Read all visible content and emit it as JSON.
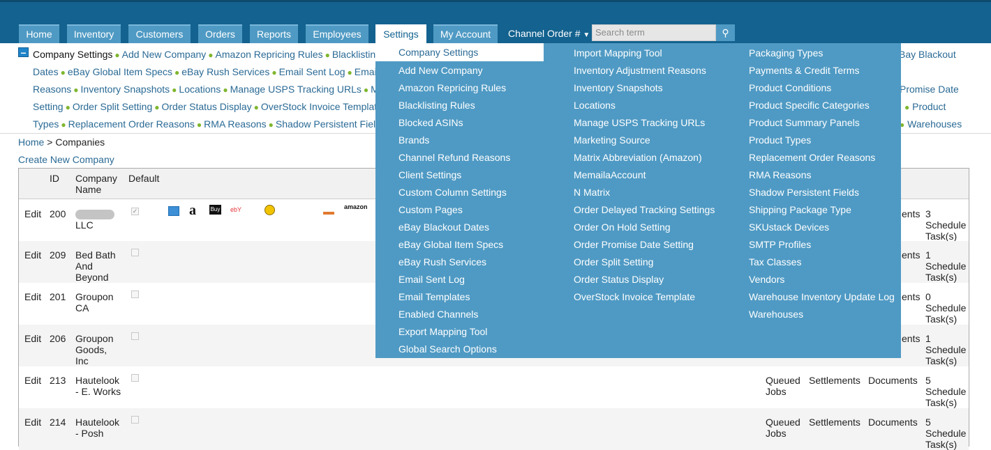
{
  "nav": {
    "tabs": [
      {
        "label": "Home"
      },
      {
        "label": "Inventory"
      },
      {
        "label": "Customers"
      },
      {
        "label": "Orders"
      },
      {
        "label": "Reports"
      },
      {
        "label": "Employees"
      },
      {
        "label": "Settings"
      },
      {
        "label": "My Account"
      }
    ],
    "channel_select": "Channel Order #",
    "channel_arrow": "▼",
    "search_placeholder": "Search term",
    "search_icon": "magnifier-icon"
  },
  "submenu": {
    "lines": [
      [
        "Company Settings",
        "Add New Company",
        "Amazon Repricing Rules",
        "Blacklisting R"
      ],
      [
        "Dates",
        "eBay Global Item Specs",
        "eBay Rush Services",
        "Email Sent Log",
        "Email T"
      ],
      [
        "Reasons",
        "Inventory Snapshots",
        "Locations",
        "Manage USPS Tracking URLs",
        "Ma"
      ],
      [
        "Setting",
        "Order Split Setting",
        "Order Status Display",
        "OverStock Invoice Template"
      ],
      [
        "Types",
        "Replacement Order Reasons",
        "RMA Reasons",
        "Shadow Persistent Fields"
      ]
    ],
    "right": [
      "Bay Blackout",
      "Promise Date",
      "Product",
      "Warehouses"
    ]
  },
  "breadcrumb": {
    "home": "Home",
    "sep": ">",
    "current": "Companies"
  },
  "create_link": "Create New Company",
  "table": {
    "headers": {
      "id": "ID",
      "name": "Company Name",
      "default": "Default"
    },
    "rows": [
      {
        "edit": "Edit",
        "id": "200",
        "name": "LLC",
        "default": true,
        "tasks": "3 Schedule Task(s)",
        "docs": "ents"
      },
      {
        "edit": "Edit",
        "id": "209",
        "name": "Bed Bath And Beyond",
        "default": false,
        "tasks": "1 Schedule Task(s)",
        "docs": "ents"
      },
      {
        "edit": "Edit",
        "id": "201",
        "name": "Groupon CA",
        "default": false,
        "tasks": "0 Schedule Task(s)",
        "docs": "ents"
      },
      {
        "edit": "Edit",
        "id": "206",
        "name": "Groupon Goods, Inc",
        "default": false,
        "tasks": "1 Schedule Task(s)",
        "docs": "ents"
      },
      {
        "edit": "Edit",
        "id": "213",
        "name": "Hautelook - E. Works",
        "default": false,
        "queued": "Queued Jobs",
        "settlements": "Settlements",
        "docs": "Documents",
        "tasks": "5 Schedule Task(s)"
      },
      {
        "edit": "Edit",
        "id": "214",
        "name": "Hautelook - Posh",
        "default": false,
        "queued": "Queued Jobs",
        "settlements": "Settlements",
        "docs": "Documents",
        "tasks": "5 Schedule Task(s)"
      }
    ],
    "logos": [
      "a",
      "Buy",
      "ebY",
      "amazon"
    ]
  },
  "dropdown": {
    "col1": [
      "Company Settings",
      "Add New Company",
      "Amazon Repricing Rules",
      "Blacklisting Rules",
      "Blocked ASINs",
      "Brands",
      "Channel Refund Reasons",
      "Client Settings",
      "Custom Column Settings",
      "Custom Pages",
      "eBay Blackout Dates",
      "eBay Global Item Specs",
      "eBay Rush Services",
      "Email Sent Log",
      "Email Templates",
      "Enabled Channels",
      "Export Mapping Tool",
      "Global Search Options"
    ],
    "col2": [
      "Import Mapping Tool",
      "Inventory Adjustment Reasons",
      "Inventory Snapshots",
      "Locations",
      "Manage USPS Tracking URLs",
      "Marketing Source",
      "Matrix Abbreviation (Amazon)",
      "MemailaAccount",
      "N Matrix",
      "Order Delayed Tracking Settings",
      "Order On Hold Setting",
      "Order Promise Date Setting",
      "Order Split Setting",
      "Order Status Display",
      "OverStock Invoice Template"
    ],
    "col3": [
      "Packaging Types",
      "Payments & Credit Terms",
      "Product Conditions",
      "Product Specific Categories",
      "Product Summary Panels",
      "Product Types",
      "Replacement Order Reasons",
      "RMA Reasons",
      "Shadow Persistent Fields",
      "Shipping Package Type",
      "SKUstack Devices",
      "SMTP Profiles",
      "Tax Classes",
      "Vendors",
      "Warehouse Inventory Update Log",
      "Warehouses"
    ]
  }
}
